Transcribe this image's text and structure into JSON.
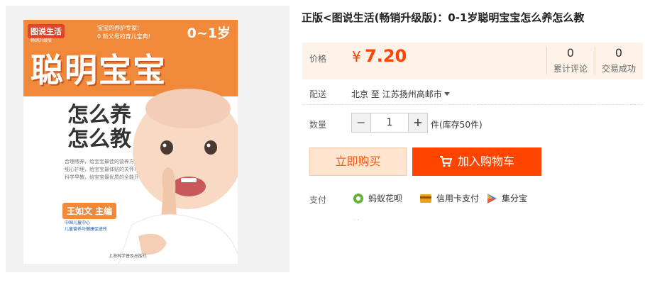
{
  "product": {
    "title": "正版<图说生活(畅销升级版)：0-1岁聪明宝宝怎么养怎么教"
  },
  "cover": {
    "series": "图说生活",
    "series_sub": "畅销升级版",
    "blurb_line1": "宝宝的养护专家!",
    "blurb_line2": "0 新父母的育儿宝典!",
    "age": "0~1岁",
    "main_title": "聪明宝宝",
    "sub_title_line1": "怎么养",
    "sub_title_line2": "怎么教",
    "desc_line1": "合理喂养，给宝宝最佳的营养方案!",
    "desc_line2": "细心护理，给宝宝最体贴的关怀!",
    "desc_line3": "科学早教，给宝宝最优质的全能开发!",
    "editor": "王如文 主编",
    "org_line1": "中国儿童中心",
    "org_line2": "儿童营养与健康促进所",
    "publisher": "上海科学普及出版社"
  },
  "price": {
    "label": "价格",
    "currency": "¥",
    "value": "7.20"
  },
  "stats": {
    "reviews_count": "0",
    "reviews_label": "累计评论",
    "deals_count": "0",
    "deals_label": "交易成功"
  },
  "shipping": {
    "label": "配送",
    "from": "北京",
    "to_word": "至",
    "destination": "江苏扬州高邮市"
  },
  "quantity": {
    "label": "数量",
    "minus": "−",
    "value": "1",
    "plus": "+",
    "stock": "件(库存50件)"
  },
  "actions": {
    "buy_now": "立即购买",
    "add_to_cart": "加入购物车"
  },
  "payment": {
    "label": "支付",
    "methods": [
      {
        "name": "蚂蚁花呗",
        "icon": "huabei-icon",
        "color": "#5fb336"
      },
      {
        "name": "信用卡支付",
        "icon": "credit-card-icon",
        "color": "#e8a317"
      },
      {
        "name": "集分宝",
        "icon": "jifenbao-icon",
        "color": "#3a8ee6"
      }
    ]
  },
  "colors": {
    "accent": "#ff4400",
    "price_bg": "#fff2e8",
    "buy_now_bg": "#ffe4d0"
  }
}
